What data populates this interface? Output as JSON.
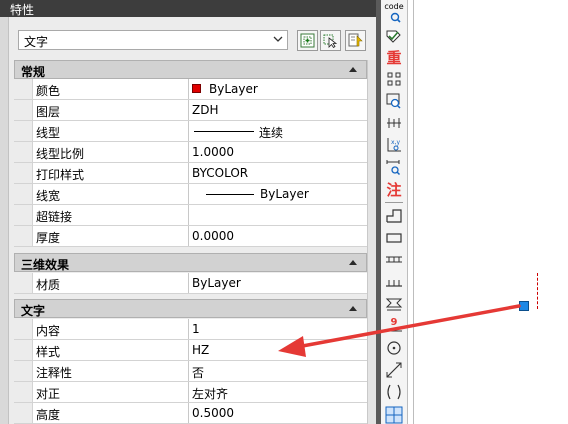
{
  "palette": {
    "title": "特性",
    "type_selector": {
      "value": "文字"
    }
  },
  "sections": [
    {
      "title": "常规",
      "rows": [
        {
          "name": "颜色",
          "value": "ByLayer"
        },
        {
          "name": "图层",
          "value": "ZDH"
        },
        {
          "name": "线型",
          "value": "连续"
        },
        {
          "name": "线型比例",
          "value": "1.0000"
        },
        {
          "name": "打印样式",
          "value": "BYCOLOR"
        },
        {
          "name": "线宽",
          "value": "ByLayer"
        },
        {
          "name": "超链接",
          "value": ""
        },
        {
          "name": "厚度",
          "value": "0.0000"
        }
      ]
    },
    {
      "title": "三维效果",
      "rows": [
        {
          "name": "材质",
          "value": "ByLayer"
        }
      ]
    },
    {
      "title": "文字",
      "rows": [
        {
          "name": "内容",
          "value": "1"
        },
        {
          "name": "样式",
          "value": "HZ"
        },
        {
          "name": "注释性",
          "value": "否"
        },
        {
          "name": "对正",
          "value": "左对齐"
        },
        {
          "name": "高度",
          "value": "0.5000"
        }
      ]
    }
  ],
  "toolbar": {
    "code_label": "code",
    "chong_label": "重",
    "zhu_label": "注",
    "nine_label": "9",
    "icons": [
      "quick-select-icon",
      "select-objects-icon",
      "pickadd-icon",
      "code-search-icon",
      "check-icon",
      "grid-icon",
      "zoom-icon",
      "dimension-icon",
      "coordinates-icon",
      "text-search-icon",
      "step-icon",
      "rectangle-icon",
      "ladder-icon",
      "bar-icon",
      "equal-icon",
      "hatch-icon",
      "circle-icon",
      "diagonal-icon",
      "curve-icon",
      "cube-icon"
    ]
  },
  "colors": {
    "color_swatch": "#e00000",
    "grip": "#1e88e5",
    "annotation_arrow": "#e53935"
  }
}
